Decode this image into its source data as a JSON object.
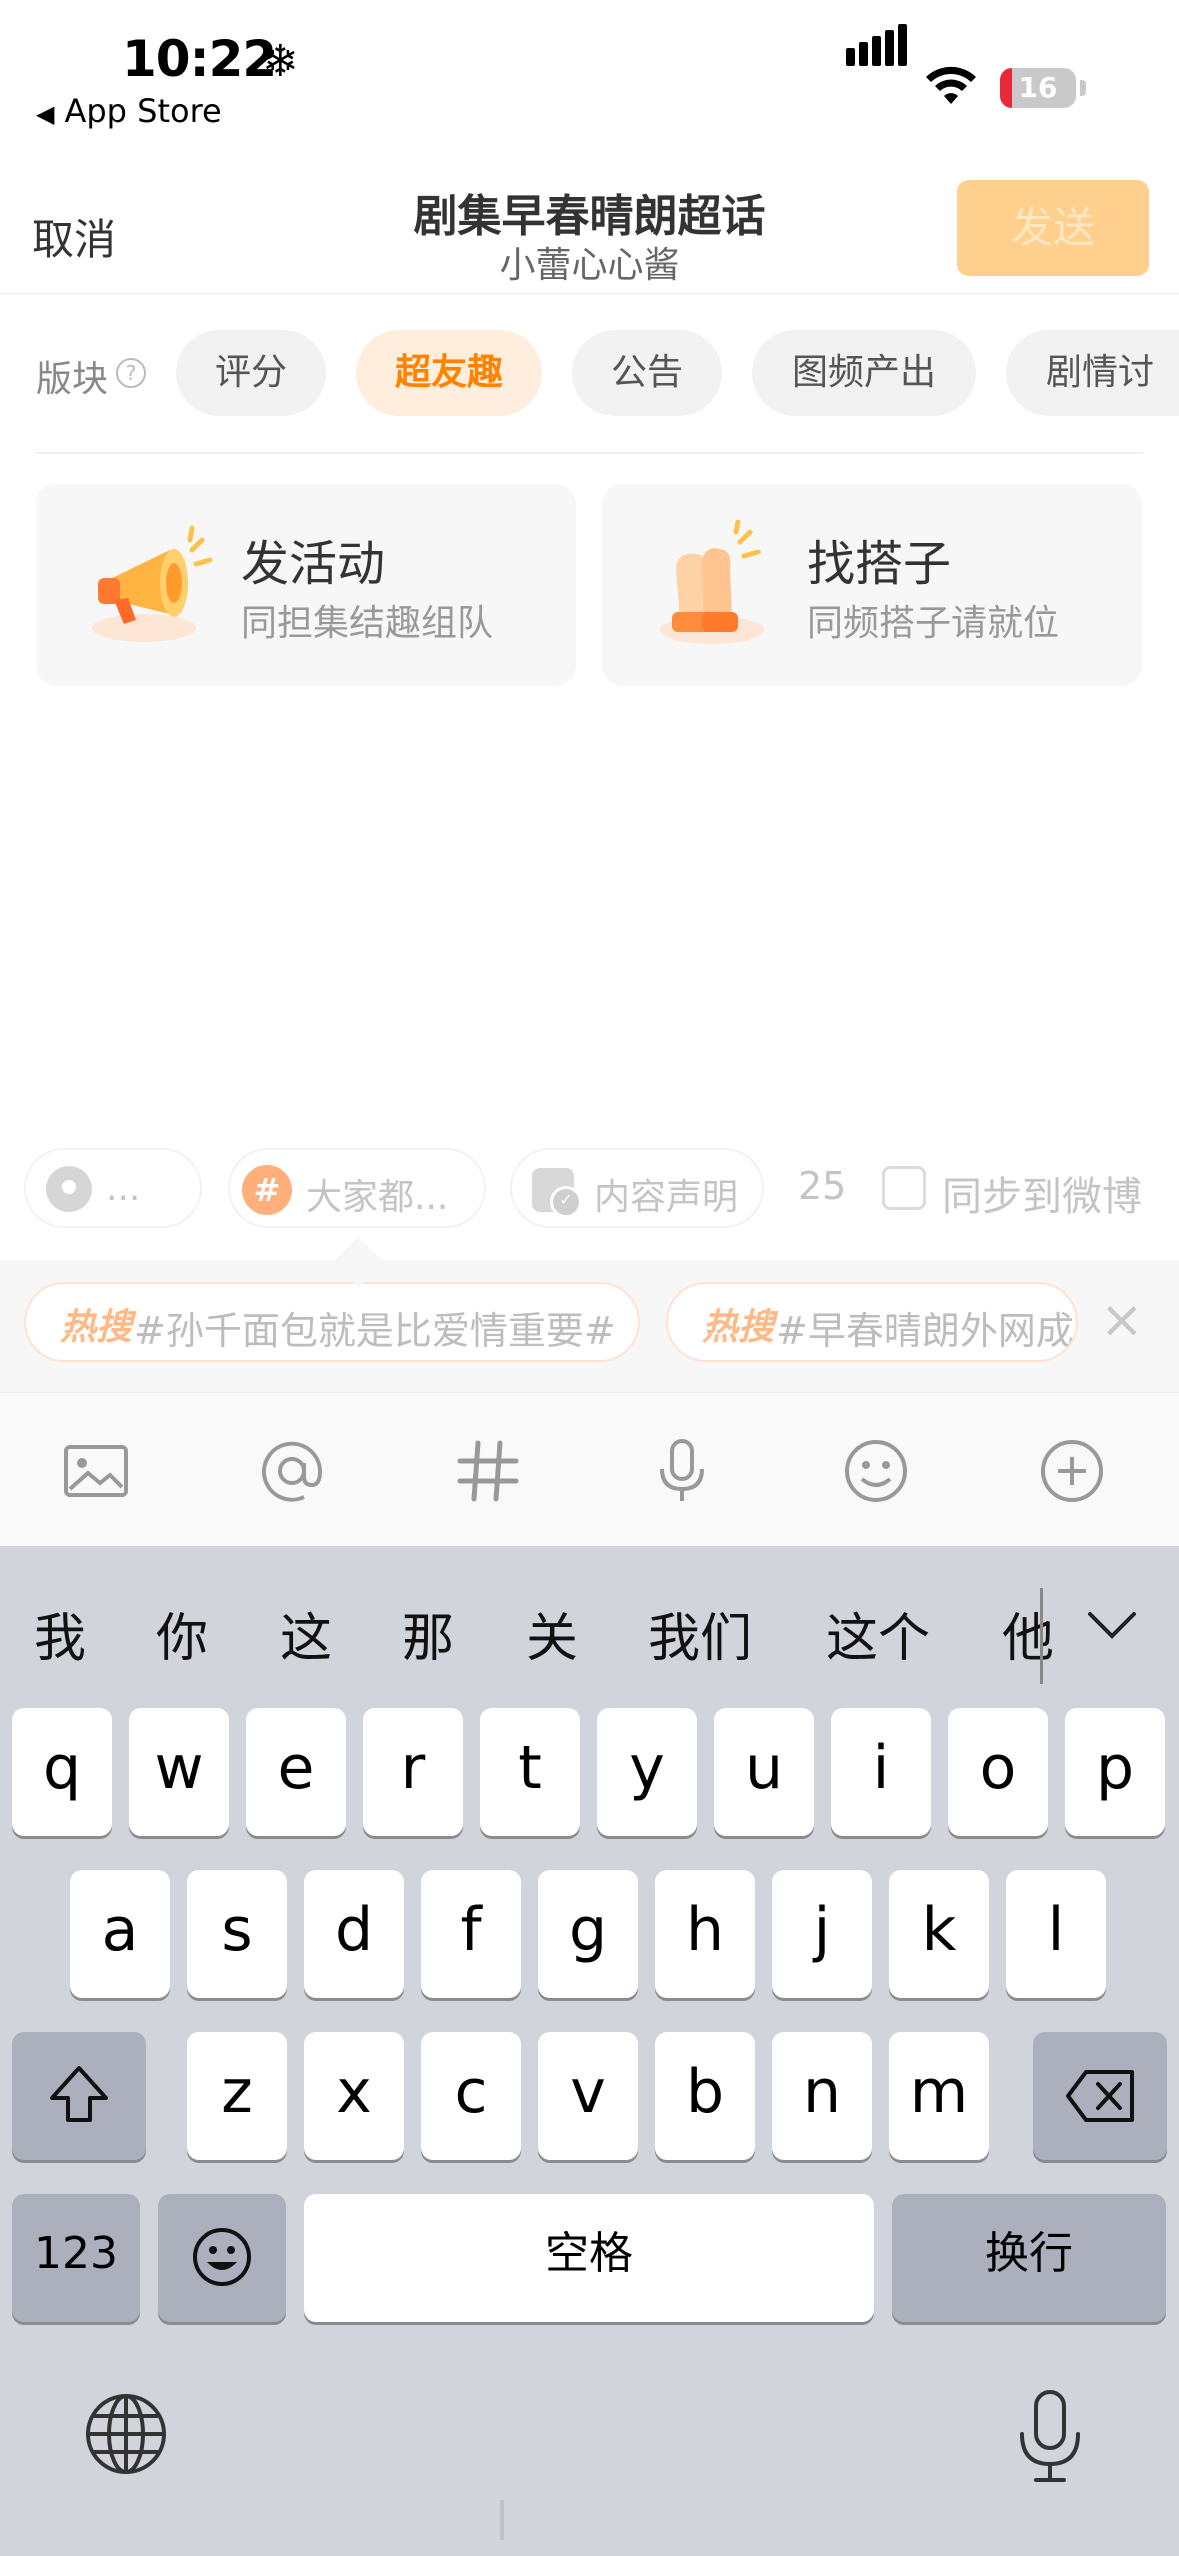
{
  "status_bar": {
    "time": "10:22",
    "weather_glyph": "❄",
    "back_app": "App Store",
    "battery": 16
  },
  "header": {
    "cancel": "取消",
    "title": "剧集早春晴朗超话",
    "subtitle": "小蕾心心酱",
    "send": "发送"
  },
  "sections": {
    "label": "版块",
    "help_icon": "question-circle-icon",
    "tabs": [
      {
        "label": "评分",
        "active": false
      },
      {
        "label": "超友趣",
        "active": true
      },
      {
        "label": "公告",
        "active": false
      },
      {
        "label": "图频产出",
        "active": false
      },
      {
        "label": "剧情讨",
        "active": false
      }
    ]
  },
  "cards": [
    {
      "title": "发活动",
      "subtitle": "同担集结趣组队",
      "icon": "megaphone-icon"
    },
    {
      "title": "找搭子",
      "subtitle": "同频搭子请就位",
      "icon": "clapping-hands-icon"
    }
  ],
  "options": {
    "location": "...",
    "topic": "大家都...",
    "declaration": "内容声明",
    "count": "25",
    "sync_label": "同步到微博",
    "sync_checked": false
  },
  "hot_search": {
    "tag": "热搜",
    "items": [
      "#孙千面包就是比爱情重要#",
      "#早春晴朗外网成"
    ]
  },
  "toolbar": {
    "icons": [
      "image-icon",
      "at-icon",
      "hashtag-icon",
      "microphone-icon",
      "emoji-icon",
      "plus-circle-icon"
    ]
  },
  "keyboard": {
    "candidates": [
      "我",
      "你",
      "这",
      "那",
      "关",
      "我们",
      "这个",
      "他"
    ],
    "row1": [
      "q",
      "w",
      "e",
      "r",
      "t",
      "y",
      "u",
      "i",
      "o",
      "p"
    ],
    "row2": [
      "a",
      "s",
      "d",
      "f",
      "g",
      "h",
      "j",
      "k",
      "l"
    ],
    "row3": [
      "z",
      "x",
      "c",
      "v",
      "b",
      "n",
      "m"
    ],
    "numbers_key": "123",
    "space_key": "空格",
    "return_key": "换行"
  },
  "colors": {
    "accent": "#ff8200",
    "send_disabled": "#ffcf8e",
    "keyboard_bg": "#d1d4db"
  }
}
